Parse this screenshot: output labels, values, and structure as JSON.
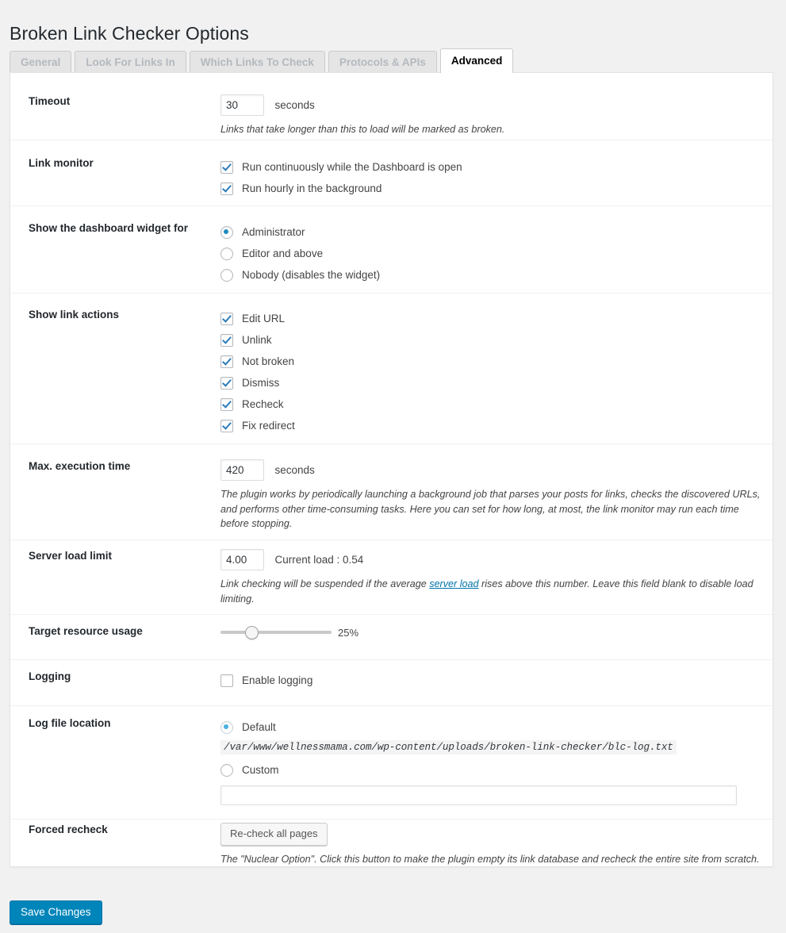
{
  "page": {
    "title": "Broken Link Checker Options"
  },
  "tabs": [
    {
      "label": "General",
      "active": false
    },
    {
      "label": "Look For Links In",
      "active": false
    },
    {
      "label": "Which Links To Check",
      "active": false
    },
    {
      "label": "Protocols & APIs",
      "active": false
    },
    {
      "label": "Advanced",
      "active": true
    }
  ],
  "settings": {
    "timeout": {
      "label": "Timeout",
      "value": "30",
      "unit": "seconds",
      "description": "Links that take longer than this to load will be marked as broken."
    },
    "link_monitor": {
      "label": "Link monitor",
      "options": [
        {
          "label": "Run continuously while the Dashboard is open",
          "checked": true
        },
        {
          "label": "Run hourly in the background",
          "checked": true
        }
      ]
    },
    "dashboard_widget": {
      "label": "Show the dashboard widget for",
      "options": [
        {
          "label": "Administrator",
          "selected": true
        },
        {
          "label": "Editor and above",
          "selected": false
        },
        {
          "label": "Nobody (disables the widget)",
          "selected": false
        }
      ]
    },
    "link_actions": {
      "label": "Show link actions",
      "options": [
        {
          "label": "Edit URL",
          "checked": true
        },
        {
          "label": "Unlink",
          "checked": true
        },
        {
          "label": "Not broken",
          "checked": true
        },
        {
          "label": "Dismiss",
          "checked": true
        },
        {
          "label": "Recheck",
          "checked": true
        },
        {
          "label": "Fix redirect",
          "checked": true
        }
      ]
    },
    "max_execution_time": {
      "label": "Max. execution time",
      "value": "420",
      "unit": "seconds",
      "description": "The plugin works by periodically launching a background job that parses your posts for links, checks the discovered URLs, and performs other time-consuming tasks. Here you can set for how long, at most, the link monitor may run each time before stopping."
    },
    "server_load_limit": {
      "label": "Server load limit",
      "value": "4.00",
      "current_load": "Current load : 0.54",
      "description_before": "Link checking will be suspended if the average ",
      "description_link": "server load",
      "description_after": " rises above this number. Leave this field blank to disable load limiting."
    },
    "target_resource_usage": {
      "label": "Target resource usage",
      "value": "25%",
      "percent": 25
    },
    "logging": {
      "label": "Logging",
      "option_label": "Enable logging",
      "checked": false
    },
    "log_file_location": {
      "label": "Log file location",
      "default_label": "Default",
      "default_selected": true,
      "default_path": "/var/www/wellnessmama.com/wp-content/uploads/broken-link-checker/blc-log.txt",
      "custom_label": "Custom",
      "custom_selected": false,
      "custom_value": "",
      "custom_placeholder": ""
    },
    "forced_recheck": {
      "label": "Forced recheck",
      "button_label": "Re-check all pages",
      "description": "The \"Nuclear Option\". Click this button to make the plugin empty its link database and recheck the entire site from scratch."
    }
  },
  "footer": {
    "save_label": "Save Changes"
  }
}
